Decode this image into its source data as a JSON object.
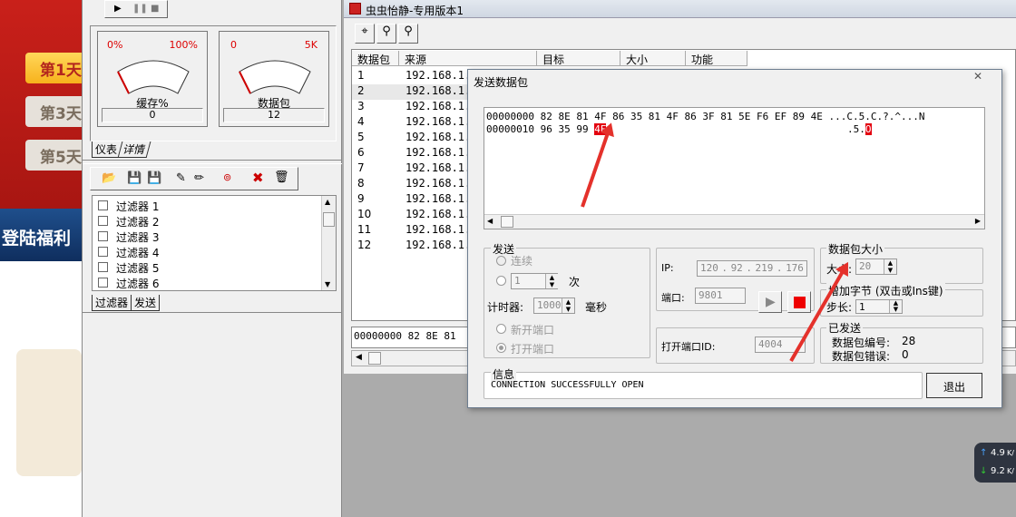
{
  "game": {
    "days": [
      "第1天",
      "第3天",
      "第5天"
    ],
    "banner": "登陆福利"
  },
  "left_panel": {
    "gauge1": {
      "min": "0%",
      "max": "100%",
      "label": "缓存%",
      "value": "0"
    },
    "gauge2": {
      "min": "0",
      "max": "5K",
      "label": "数据包",
      "value": "12"
    },
    "tabs_top": [
      "仪表",
      "详情"
    ],
    "filters": [
      "过滤器 1",
      "过滤器 2",
      "过滤器 3",
      "过滤器 4",
      "过滤器 5",
      "过滤器 6"
    ],
    "tabs_bottom": [
      "过滤器",
      "发送"
    ]
  },
  "main_window": {
    "title": "虫虫怡静-专用版本1",
    "columns": [
      "数据包",
      "来源",
      "目标",
      "大小",
      "功能"
    ],
    "rows": [
      {
        "n": "1",
        "src": "192.168.1."
      },
      {
        "n": "2",
        "src": "192.168.1."
      },
      {
        "n": "3",
        "src": "192.168.1."
      },
      {
        "n": "4",
        "src": "192.168.1."
      },
      {
        "n": "5",
        "src": "192.168.1."
      },
      {
        "n": "6",
        "src": "192.168.1."
      },
      {
        "n": "7",
        "src": "192.168.1."
      },
      {
        "n": "8",
        "src": "192.168.1."
      },
      {
        "n": "9",
        "src": "192.168.1."
      },
      {
        "n": "10",
        "src": "192.168.1."
      },
      {
        "n": "11",
        "src": "192.168.1."
      },
      {
        "n": "12",
        "src": "192.168.1."
      }
    ],
    "hex_preview": "00000000 82 8E 81"
  },
  "dialog": {
    "title": "发送数据包",
    "hex_line1": "00000000 82 8E 81 4F 86 35 81 4F 86 3F 81 5E F6 EF 89 4E ...C.5.C.?.^...N",
    "hex_line2_prefix": "00000010 96 35 99 ",
    "hex_line2_selected": "4E",
    "hex_line2_ascii_prefix": ".5.",
    "hex_line2_ascii_selected": "O",
    "send_group": "发送",
    "continuous": "连续",
    "count_value": "1",
    "count_unit": "次",
    "timer_label": "计时器:",
    "timer_value": "1000",
    "timer_unit": "毫秒",
    "new_port": "新开端口",
    "open_port": "打开端口",
    "ip_label": "IP:",
    "ip_octets": [
      "120",
      "92",
      "219",
      "176"
    ],
    "port_label": "端口:",
    "port_value": "9801",
    "open_port_id_label": "打开端口ID:",
    "open_port_id_value": "4004",
    "size_group": "数据包大小",
    "size_label": "大小:",
    "size_value": "20",
    "incr_group": "增加字节 (双击或Ins键)",
    "step_label": "步长:",
    "step_value": "1",
    "sent_group": "已发送",
    "packet_no_label": "数据包编号:",
    "packet_no_value": "28",
    "packet_err_label": "数据包错误:",
    "packet_err_value": "0",
    "info_group": "信息",
    "info_text": "CONNECTION SUCCESSFULLY OPEN",
    "exit_label": "退出",
    "close_glyph": "✕"
  },
  "network": {
    "up": "4.9",
    "down": "9.2",
    "unit": "K/"
  },
  "colors": {
    "highlight": "#e3000f",
    "arrow": "#e4312b",
    "dialog_border": "#6d7d90"
  }
}
